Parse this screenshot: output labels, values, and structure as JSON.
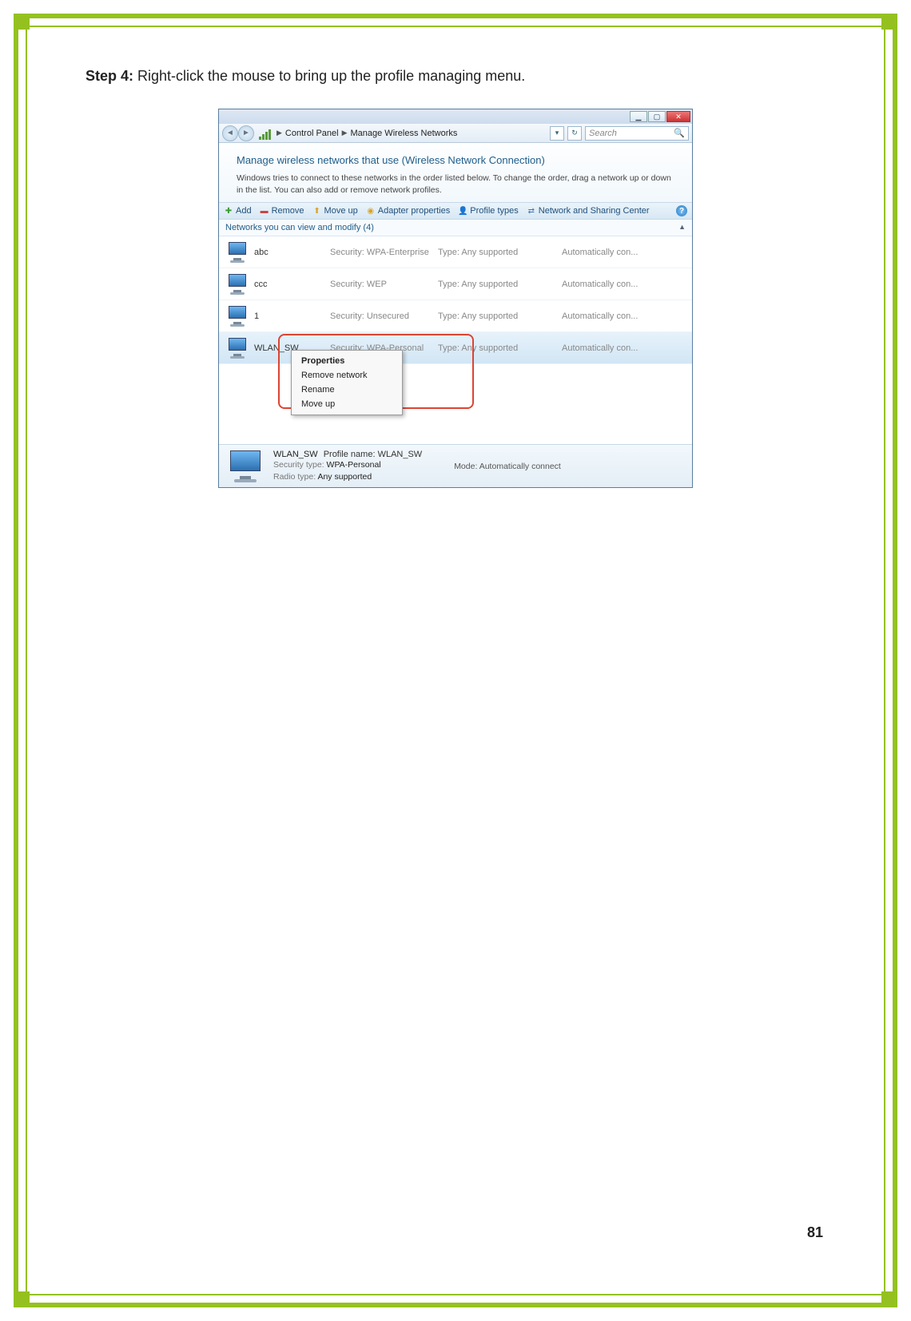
{
  "page": {
    "step_label": "Step 4:",
    "step_text": " Right-click the mouse to bring up the profile managing menu.",
    "number": "81"
  },
  "window": {
    "breadcrumb": {
      "seg1": "Control Panel",
      "seg2": "Manage Wireless Networks"
    },
    "search_placeholder": "Search",
    "heading": "Manage wireless networks that use (Wireless Network Connection)",
    "description": "Windows tries to connect to these networks in the order listed below. To change the order, drag a network up or down in the list. You can also add or remove network profiles.",
    "toolbar": {
      "add": "Add",
      "remove": "Remove",
      "moveup": "Move up",
      "adapter": "Adapter properties",
      "profile": "Profile types",
      "nsc": "Network and Sharing Center"
    },
    "section_label": "Networks you can view and modify (4)",
    "rows": [
      {
        "name": "abc",
        "sec": "Security:  WPA-Enterprise",
        "type": "Type:  Any supported",
        "auto": "Automatically con..."
      },
      {
        "name": "ccc",
        "sec": "Security:  WEP",
        "type": "Type:  Any supported",
        "auto": "Automatically con..."
      },
      {
        "name": "1",
        "sec": "Security:  Unsecured",
        "type": "Type:  Any supported",
        "auto": "Automatically con..."
      },
      {
        "name": "WLAN_SW",
        "sec": "Security:  WPA-Personal",
        "type": "Type:  Any supported",
        "auto": "Automatically con..."
      }
    ],
    "context_menu": {
      "properties": "Properties",
      "remove": "Remove network",
      "rename": "Rename",
      "moveup": "Move up"
    },
    "details": {
      "name": "WLAN_SW",
      "profile_k": "Profile name:",
      "profile_v": "WLAN_SW",
      "sectype_k": "Security type:",
      "sectype_v": "WPA-Personal",
      "radio_k": "Radio type:",
      "radio_v": "Any supported",
      "mode_k": "Mode:",
      "mode_v": "Automatically connect"
    }
  }
}
